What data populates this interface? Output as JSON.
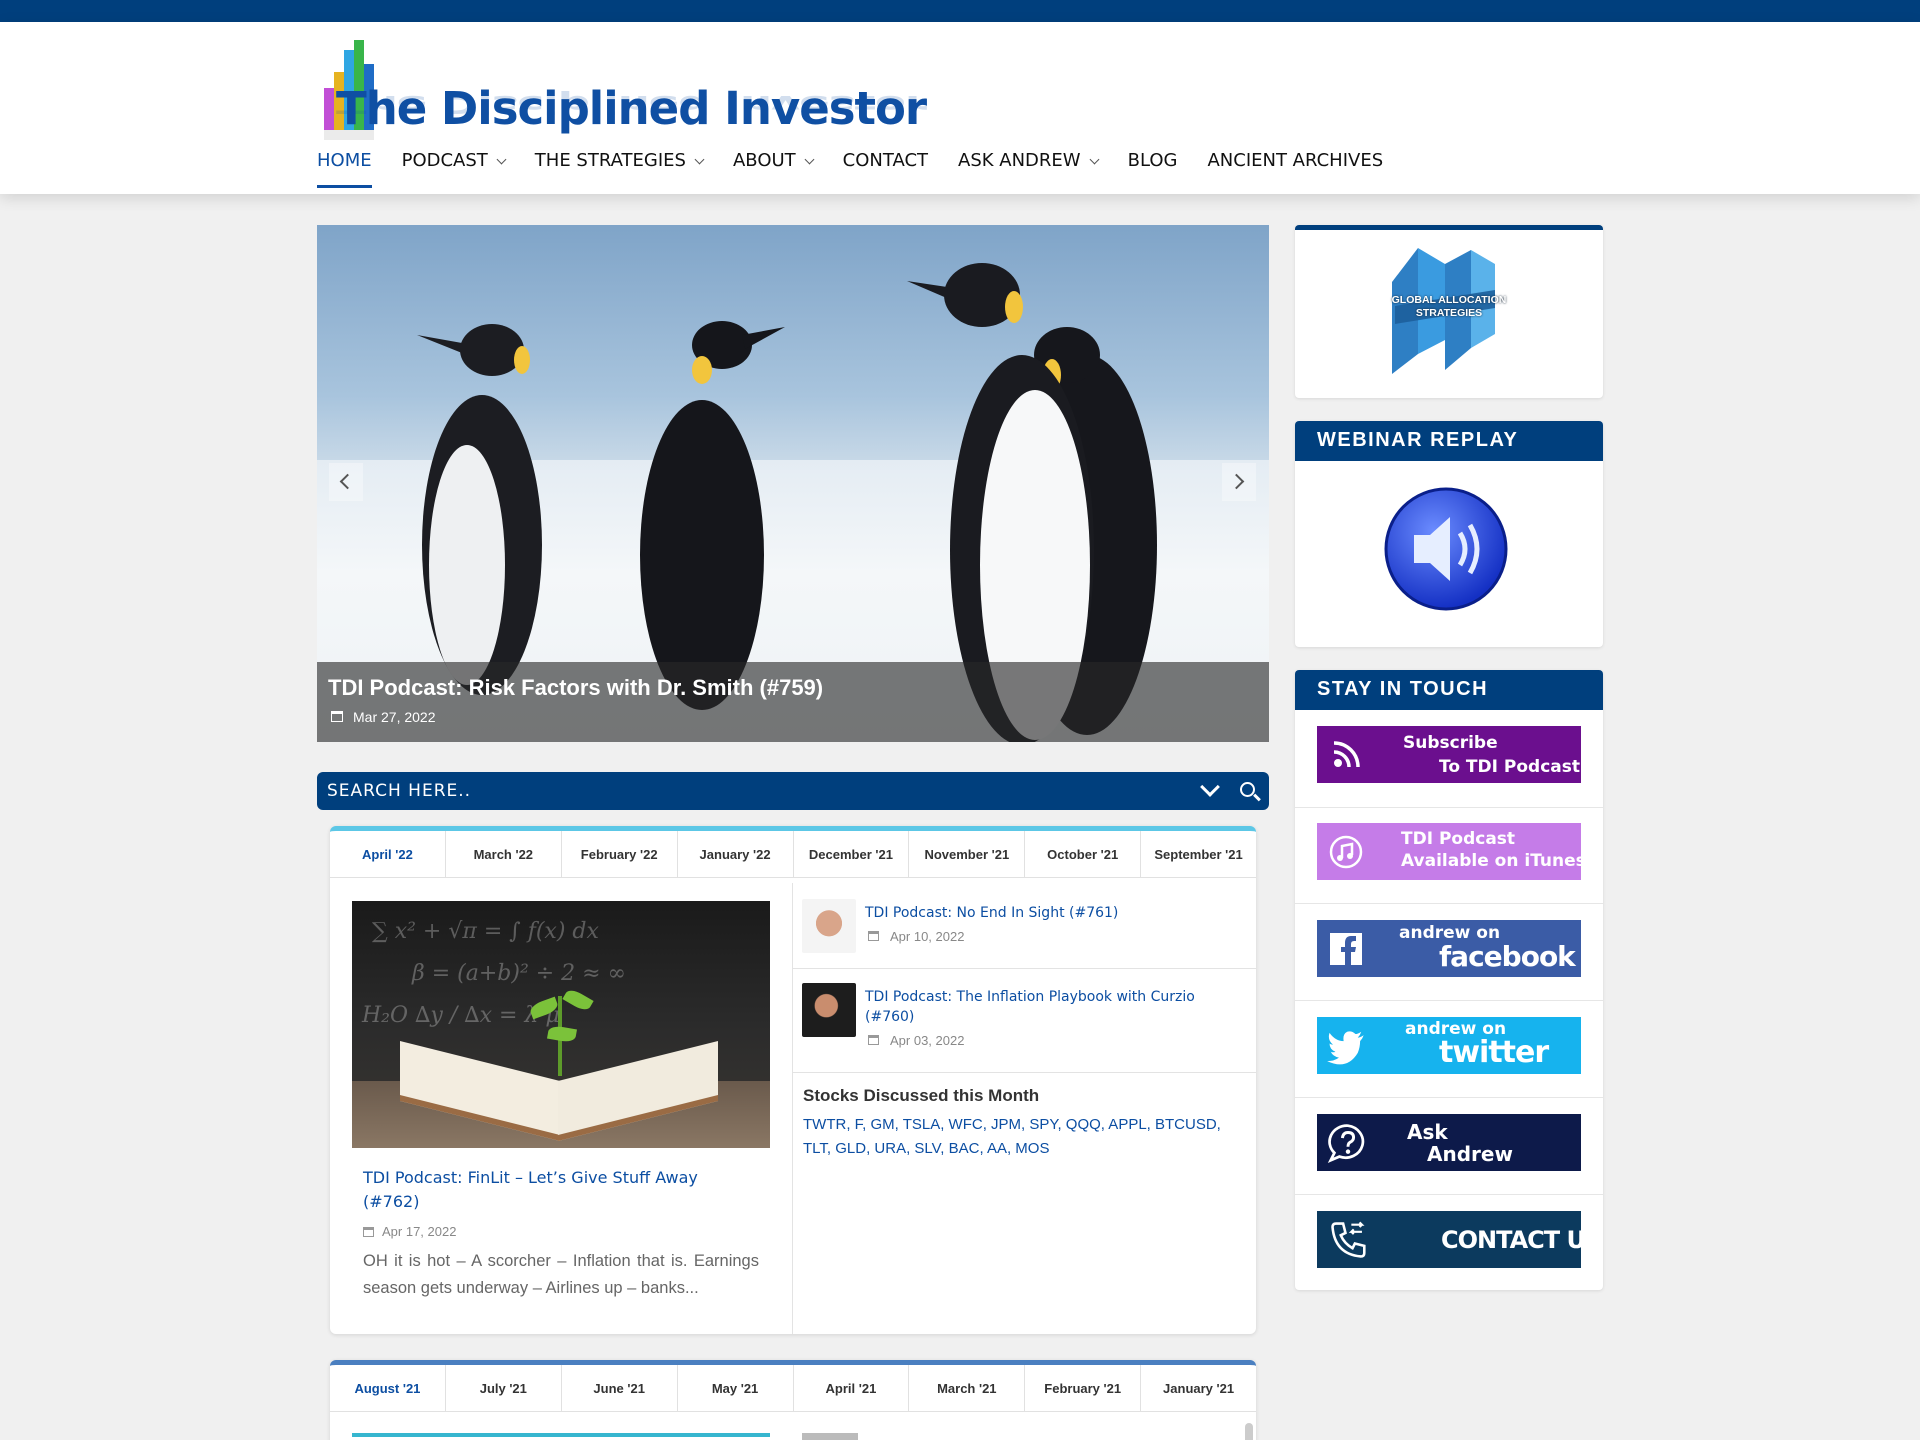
{
  "site": {
    "logo_text": "The Disciplined Investor"
  },
  "nav": {
    "items": [
      {
        "label": "HOME",
        "active": true,
        "dropdown": false
      },
      {
        "label": "PODCAST",
        "dropdown": true
      },
      {
        "label": "THE STRATEGIES",
        "dropdown": true
      },
      {
        "label": "ABOUT",
        "dropdown": true
      },
      {
        "label": "CONTACT",
        "dropdown": false
      },
      {
        "label": "ASK ANDREW",
        "dropdown": true
      },
      {
        "label": "BLOG",
        "dropdown": false
      },
      {
        "label": "ANCIENT ARCHIVES",
        "dropdown": false
      }
    ]
  },
  "hero": {
    "title": "TDI Podcast: Risk Factors with Dr. Smith (#759)",
    "date": "Mar 27, 2022",
    "prev_icon": "chevron-left-icon",
    "next_icon": "chevron-right-icon"
  },
  "search": {
    "placeholder": "SEARCH HERE.."
  },
  "archive1": {
    "tabs": [
      "April '22",
      "March '22",
      "February '22",
      "January '22",
      "December '21",
      "November '21",
      "October '21",
      "September '21"
    ],
    "active_tab": 0,
    "featured": {
      "title": "TDI Podcast: FinLit – Let’s Give Stuff Away (#762)",
      "date": "Apr 17, 2022",
      "excerpt": "OH it is hot – A scorcher – Inflation that is. Earnings season gets underway – Airlines up – banks..."
    },
    "posts": [
      {
        "title": "TDI Podcast: No End In Sight (#761)",
        "date": "Apr 10, 2022"
      },
      {
        "title": "TDI Podcast: The Inflation Playbook with Curzio (#760)",
        "date": "Apr 03, 2022"
      }
    ],
    "stocks_heading": "Stocks Discussed this Month",
    "stocks_list": "TWTR, F, GM, TSLA, WFC, JPM, SPY, QQQ, APPL, BTCUSD, TLT, GLD, URA, SLV, BAC, AA, MOS"
  },
  "archive2": {
    "tabs": [
      "August '21",
      "July '21",
      "June '21",
      "May '21",
      "April '21",
      "March '21",
      "February '21",
      "January '21"
    ],
    "active_tab": 0
  },
  "sidebar": {
    "gas_logo_text": "GLOBAL ALLOCATION STRATEGIES",
    "webinar_heading": "WEBINAR REPLAY",
    "touch_heading": "STAY IN TOUCH",
    "buttons": {
      "subscribe": {
        "line1": "Subscribe",
        "line2": "To TDI Podcast",
        "color": "#6b0f8e"
      },
      "itunes": {
        "line1": "TDI Podcast",
        "line2": "Available on iTunes",
        "color": "#c57ce8"
      },
      "facebook": {
        "line1": "andrew on",
        "line2": "facebook",
        "color": "#3b5ca6"
      },
      "twitter": {
        "line1": "andrew on",
        "line2": "twitter",
        "color": "#16b3ee"
      },
      "ask": {
        "line1": "Ask",
        "line2": "Andrew",
        "color": "#0d1a4a"
      },
      "contact": {
        "line1": "CONTACT US",
        "color": "#0c3a5e"
      }
    }
  }
}
